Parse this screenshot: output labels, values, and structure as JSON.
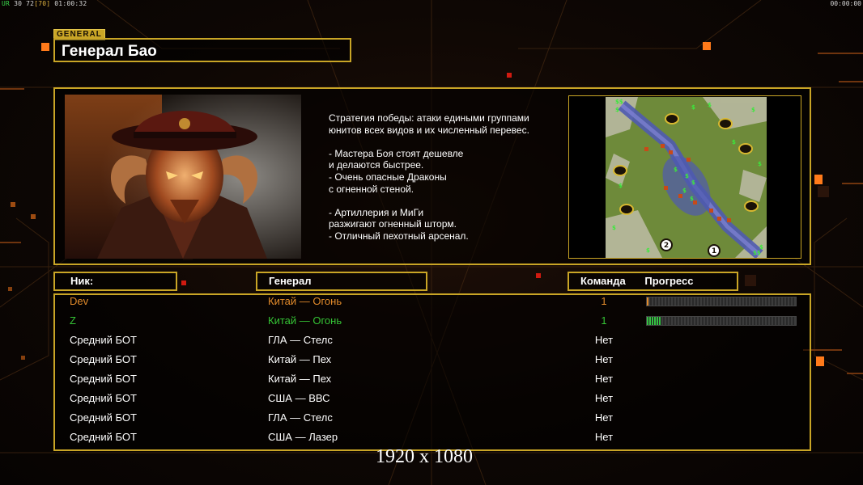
{
  "hud": {
    "left_prefix": "UR",
    "left_fps": "30 72",
    "left_bracket": "[70]",
    "left_time": "01:00:32",
    "right_time": "00:00:00"
  },
  "general_tab": "GENERAL",
  "general_name": "Генерал Бао",
  "strategy_text": "Стратегия победы: атаки едиными группами\nюнитов всех видов и их численный перевес.\n\n- Мастера Боя стоят дешевле\nи делаются быстрее.\n- Очень опасные Драконы\nс огненной стеной.\n\n- Артиллерия и МиГи\nразжигают огненный шторм.\n- Отличный пехотный арсенал.",
  "headers": {
    "nick": "Ник:",
    "general": "Генерал",
    "team": "Команда",
    "progress": "Прогресс"
  },
  "players": [
    {
      "nick": "Dev",
      "general": "Китай — Огонь",
      "team": "1",
      "progress": 0.01,
      "color": "#e28b2b",
      "bar_color": "#e28b2b"
    },
    {
      "nick": "Z",
      "general": "Китай — Огонь",
      "team": "1",
      "progress": 0.1,
      "color": "#35c435",
      "bar_color": "#34c043"
    },
    {
      "nick": "Средний БОТ",
      "general": "ГЛА — Стелс",
      "team": "Нет",
      "color": "#ffffff"
    },
    {
      "nick": "Средний БОТ",
      "general": "Китай — Пех",
      "team": "Нет",
      "color": "#ffffff"
    },
    {
      "nick": "Средний БОТ",
      "general": "Китай — Пех",
      "team": "Нет",
      "color": "#ffffff"
    },
    {
      "nick": "Средний БОТ",
      "general": "США — ВВС",
      "team": "Нет",
      "color": "#ffffff"
    },
    {
      "nick": "Средний БОТ",
      "general": "ГЛА — Стелс",
      "team": "Нет",
      "color": "#ffffff"
    },
    {
      "nick": "Средний БОТ",
      "general": "США — Лазер",
      "team": "Нет",
      "color": "#ffffff"
    }
  ],
  "minimap": {
    "start_markers": [
      "1",
      "2"
    ]
  },
  "resolution_text": "1920 x 1080",
  "colors": {
    "frame_gold": "#c9a526",
    "accent_orange": "#ff7a1a"
  }
}
